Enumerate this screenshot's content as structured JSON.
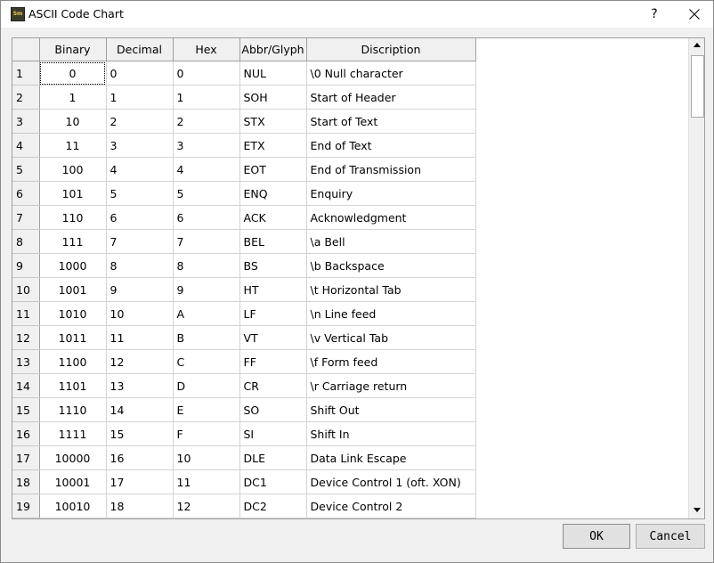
{
  "window": {
    "title": "ASCII Code Chart",
    "app_icon_text": "Sm",
    "help_label": "?",
    "close_icon": "close-icon"
  },
  "table": {
    "columns": [
      "Binary",
      "Decimal",
      "Hex",
      "Abbr/Glyph",
      "Discription"
    ],
    "rows": [
      {
        "n": "1",
        "binary": "0",
        "decimal": "0",
        "hex": "0",
        "abbr": "NUL",
        "desc": "\\0 Null character"
      },
      {
        "n": "2",
        "binary": "1",
        "decimal": "1",
        "hex": "1",
        "abbr": "SOH",
        "desc": "Start of Header"
      },
      {
        "n": "3",
        "binary": "10",
        "decimal": "2",
        "hex": "2",
        "abbr": "STX",
        "desc": "Start of Text"
      },
      {
        "n": "4",
        "binary": "11",
        "decimal": "3",
        "hex": "3",
        "abbr": "ETX",
        "desc": "End of Text"
      },
      {
        "n": "5",
        "binary": "100",
        "decimal": "4",
        "hex": "4",
        "abbr": "EOT",
        "desc": "End of Transmission"
      },
      {
        "n": "6",
        "binary": "101",
        "decimal": "5",
        "hex": "5",
        "abbr": "ENQ",
        "desc": "Enquiry"
      },
      {
        "n": "7",
        "binary": "110",
        "decimal": "6",
        "hex": "6",
        "abbr": "ACK",
        "desc": "Acknowledgment"
      },
      {
        "n": "8",
        "binary": "111",
        "decimal": "7",
        "hex": "7",
        "abbr": "BEL",
        "desc": "\\a Bell"
      },
      {
        "n": "9",
        "binary": "1000",
        "decimal": "8",
        "hex": "8",
        "abbr": "BS",
        "desc": "\\b Backspace"
      },
      {
        "n": "10",
        "binary": "1001",
        "decimal": "9",
        "hex": "9",
        "abbr": "HT",
        "desc": "\\t Horizontal Tab"
      },
      {
        "n": "11",
        "binary": "1010",
        "decimal": "10",
        "hex": "A",
        "abbr": "LF",
        "desc": "\\n Line feed"
      },
      {
        "n": "12",
        "binary": "1011",
        "decimal": "11",
        "hex": "B",
        "abbr": "VT",
        "desc": "\\v Vertical Tab"
      },
      {
        "n": "13",
        "binary": "1100",
        "decimal": "12",
        "hex": "C",
        "abbr": "FF",
        "desc": "\\f Form feed"
      },
      {
        "n": "14",
        "binary": "1101",
        "decimal": "13",
        "hex": "D",
        "abbr": "CR",
        "desc": "\\r Carriage return"
      },
      {
        "n": "15",
        "binary": "1110",
        "decimal": "14",
        "hex": "E",
        "abbr": "SO",
        "desc": "Shift Out"
      },
      {
        "n": "16",
        "binary": "1111",
        "decimal": "15",
        "hex": "F",
        "abbr": "SI",
        "desc": "Shift In"
      },
      {
        "n": "17",
        "binary": "10000",
        "decimal": "16",
        "hex": "10",
        "abbr": "DLE",
        "desc": "Data Link Escape"
      },
      {
        "n": "18",
        "binary": "10001",
        "decimal": "17",
        "hex": "11",
        "abbr": "DC1",
        "desc": "Device Control 1 (oft. XON)"
      },
      {
        "n": "19",
        "binary": "10010",
        "decimal": "18",
        "hex": "12",
        "abbr": "DC2",
        "desc": "Device Control 2"
      }
    ]
  },
  "buttons": {
    "ok": "OK",
    "cancel": "Cancel"
  },
  "colors": {
    "header_bg": "#f0f0f0",
    "grid_line": "#d4d4d4",
    "dialog_bg": "#f0f0f0"
  }
}
